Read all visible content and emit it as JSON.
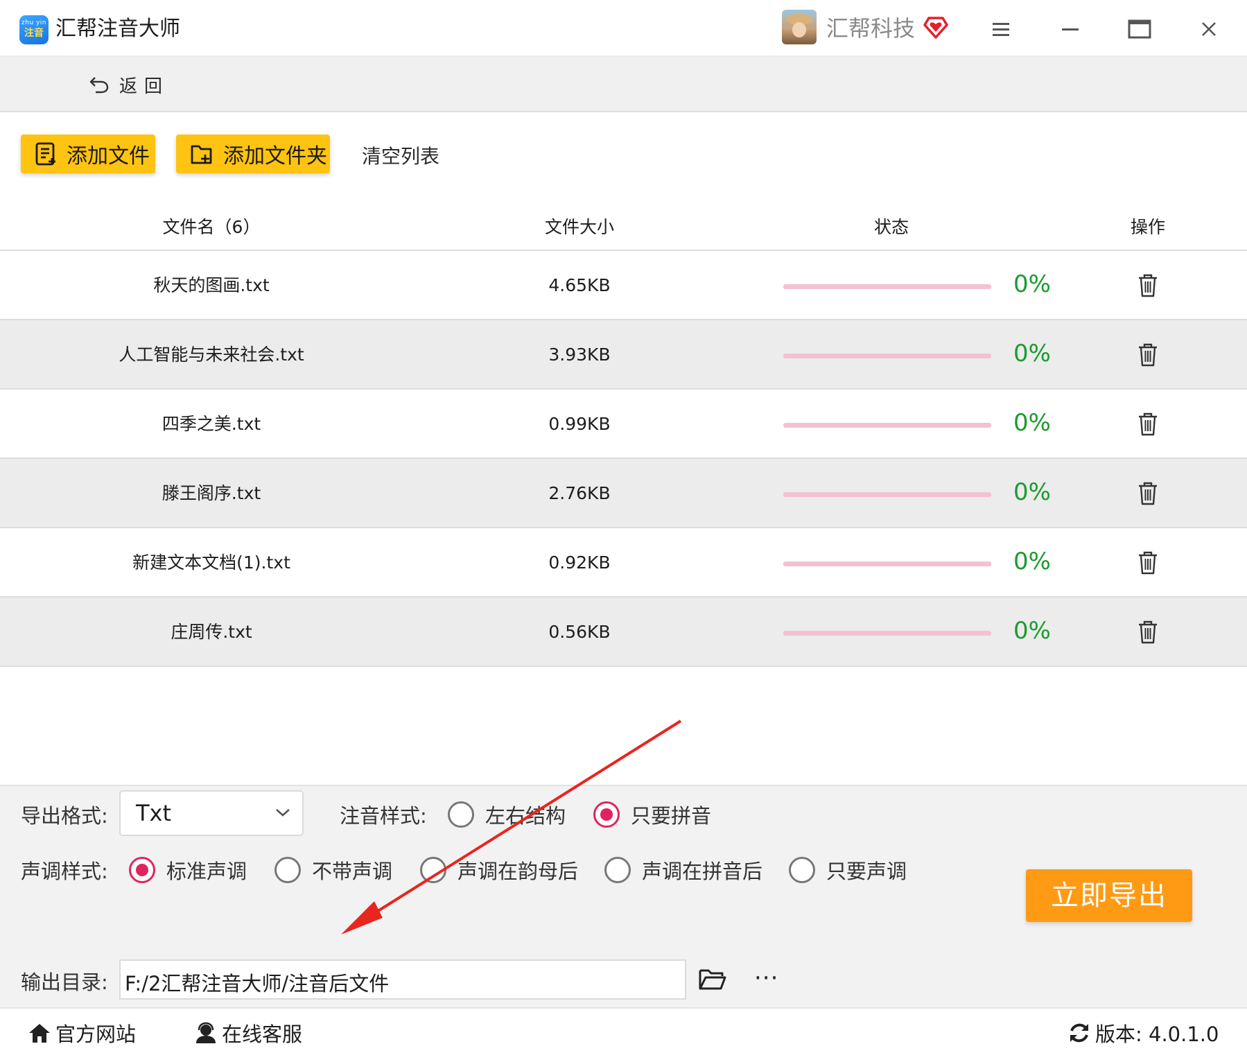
{
  "app": {
    "title": "汇帮注音大师",
    "logo_top": "zhu yin",
    "logo_bottom": "注音",
    "user_name": "汇帮科技"
  },
  "nav": {
    "back_label": "返回"
  },
  "toolbar": {
    "add_file": "添加文件",
    "add_folder": "添加文件夹",
    "clear_list": "清空列表"
  },
  "table": {
    "headers": {
      "name": "文件名（6）",
      "size": "文件大小",
      "status": "状态",
      "action": "操作"
    },
    "rows": [
      {
        "name": "秋天的图画.txt",
        "size": "4.65KB",
        "progress": "0%"
      },
      {
        "name": "人工智能与未来社会.txt",
        "size": "3.93KB",
        "progress": "0%"
      },
      {
        "name": "四季之美.txt",
        "size": "0.99KB",
        "progress": "0%"
      },
      {
        "name": "滕王阁序.txt",
        "size": "2.76KB",
        "progress": "0%"
      },
      {
        "name": "新建文本文档(1).txt",
        "size": "0.92KB",
        "progress": "0%"
      },
      {
        "name": "庄周传.txt",
        "size": "0.56KB",
        "progress": "0%"
      }
    ]
  },
  "settings": {
    "format_label": "导出格式:",
    "format_value": "Txt",
    "zhuyin_label": "注音样式:",
    "zhuyin_options": [
      {
        "label": "左右结构",
        "selected": false
      },
      {
        "label": "只要拼音",
        "selected": true
      }
    ],
    "tone_label": "声调样式:",
    "tone_options": [
      {
        "label": "标准声调",
        "selected": true
      },
      {
        "label": "不带声调",
        "selected": false
      },
      {
        "label": "声调在韵母后",
        "selected": false
      },
      {
        "label": "声调在拼音后",
        "selected": false
      },
      {
        "label": "只要声调",
        "selected": false
      }
    ],
    "export_button": "立即导出",
    "output_label": "输出目录:",
    "output_path": "F:/2汇帮注音大师/注音后文件",
    "more_label": "···"
  },
  "footer": {
    "website": "官方网站",
    "support": "在线客服",
    "version": "版本: 4.0.1.0"
  },
  "colors": {
    "accent_yellow": "#ffc311",
    "export_orange": "#ff9a14",
    "radio_active": "#e0245e",
    "progress_text": "#1a9c2e",
    "progress_track": "#f4c1d0",
    "annotation_arrow": "#e8251f"
  },
  "icons": {
    "back": "undo-arrow-icon",
    "add_file": "file-list-icon",
    "add_folder": "folder-plus-icon",
    "delete": "trash-icon",
    "folder": "folder-open-icon",
    "home": "home-icon",
    "support": "headset-user-icon",
    "refresh": "refresh-icon",
    "vip": "diamond-heart-icon"
  }
}
